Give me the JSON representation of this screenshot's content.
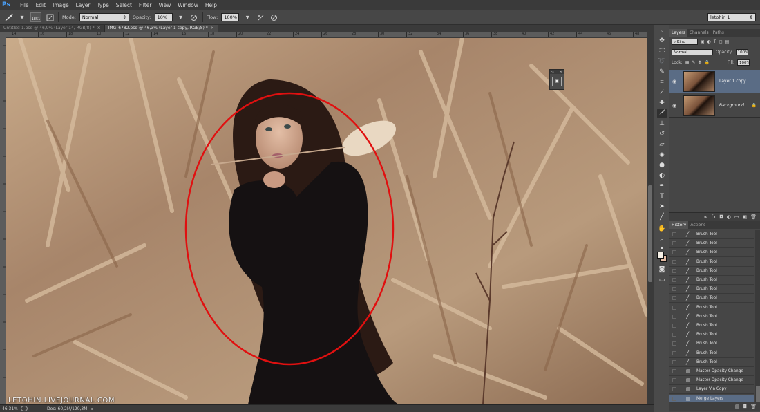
{
  "app": {
    "logo": "Ps"
  },
  "menu": [
    "File",
    "Edit",
    "Image",
    "Layer",
    "Type",
    "Select",
    "Filter",
    "View",
    "Window",
    "Help"
  ],
  "options": {
    "brush_size": "1851",
    "mode_label": "Mode:",
    "mode_value": "Normal",
    "opacity_label": "Opacity:",
    "opacity_value": "10%",
    "flow_label": "Flow:",
    "flow_value": "100%",
    "workspace": "letohin 1"
  },
  "tabs": [
    {
      "label": "Untitled-1.psd @ 46,9% (Layer 14, RGB/8) *",
      "close": "×"
    },
    {
      "label": "IMG_6782.psd @ 46,3% (Layer 1 copy, RGB/8) *",
      "close": "×"
    }
  ],
  "ruler_ticks": [
    "14",
    "16",
    "18",
    "10",
    "12",
    "14",
    "16",
    "18",
    "20",
    "22",
    "24",
    "26",
    "28",
    "30",
    "32",
    "34",
    "36",
    "38",
    "40",
    "42",
    "44",
    "46",
    "48"
  ],
  "canvas": {
    "watermark": "LETOHIN.LIVEJOURNAL.COM"
  },
  "status": {
    "zoom": "46,31%",
    "doc": "Doc: 60,2M/120,3M"
  },
  "layers_panel": {
    "tabs": [
      "Layers",
      "Channels",
      "Paths"
    ],
    "kind_label": "Kind",
    "blend_mode": "Normal",
    "opacity_label": "Opacity:",
    "opacity_value": "100%",
    "lock_label": "Lock:",
    "fill_label": "Fill:",
    "fill_value": "100%",
    "layers": [
      {
        "name": "Layer 1 copy",
        "selected": true
      },
      {
        "name": "Background",
        "selected": false
      }
    ]
  },
  "history_panel": {
    "tabs": [
      "History",
      "Actions"
    ],
    "items": [
      {
        "label": "Brush Tool",
        "icon": "brush-icon"
      },
      {
        "label": "Brush Tool",
        "icon": "brush-icon"
      },
      {
        "label": "Brush Tool",
        "icon": "brush-icon"
      },
      {
        "label": "Brush Tool",
        "icon": "brush-icon"
      },
      {
        "label": "Brush Tool",
        "icon": "brush-icon"
      },
      {
        "label": "Brush Tool",
        "icon": "brush-icon"
      },
      {
        "label": "Brush Tool",
        "icon": "brush-icon"
      },
      {
        "label": "Brush Tool",
        "icon": "brush-icon"
      },
      {
        "label": "Brush Tool",
        "icon": "brush-icon"
      },
      {
        "label": "Brush Tool",
        "icon": "brush-icon"
      },
      {
        "label": "Brush Tool",
        "icon": "brush-icon"
      },
      {
        "label": "Brush Tool",
        "icon": "brush-icon"
      },
      {
        "label": "Brush Tool",
        "icon": "brush-icon"
      },
      {
        "label": "Brush Tool",
        "icon": "brush-icon"
      },
      {
        "label": "Brush Tool",
        "icon": "brush-icon"
      },
      {
        "label": "Master Opacity Change",
        "icon": "doc-icon"
      },
      {
        "label": "Master Opacity Change",
        "icon": "doc-icon"
      },
      {
        "label": "Layer Via Copy",
        "icon": "doc-icon"
      },
      {
        "label": "Merge Layers",
        "icon": "doc-icon"
      }
    ]
  },
  "colors": {
    "accent_selection": "#5a6c85",
    "annotation": "#e01010",
    "foreground": "#f6f0e6",
    "background": "#e5bca4"
  }
}
